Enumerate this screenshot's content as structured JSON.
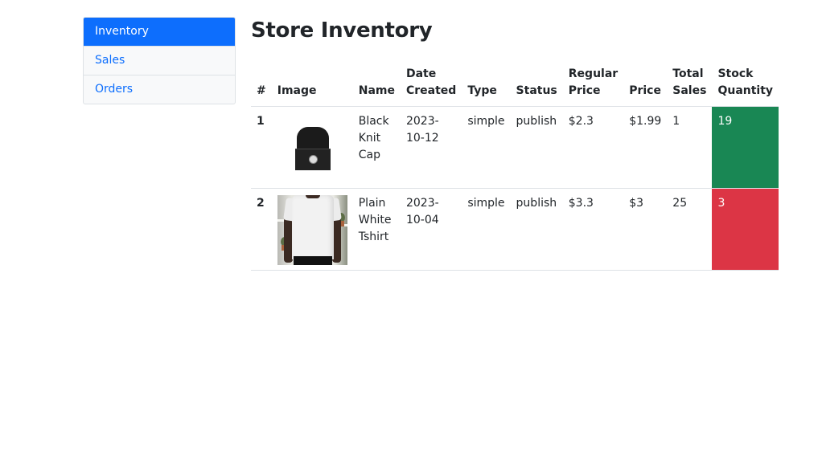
{
  "sidebar": {
    "items": [
      {
        "label": "Inventory",
        "active": true
      },
      {
        "label": "Sales",
        "active": false
      },
      {
        "label": "Orders",
        "active": false
      }
    ]
  },
  "page": {
    "title": "Store Inventory"
  },
  "table": {
    "headers": [
      {
        "line1": "",
        "line2": "#"
      },
      {
        "line1": "",
        "line2": "Image"
      },
      {
        "line1": "",
        "line2": "Name"
      },
      {
        "line1": "Date",
        "line2": "Created"
      },
      {
        "line1": "",
        "line2": "Type"
      },
      {
        "line1": "",
        "line2": "Status"
      },
      {
        "line1": "Regular",
        "line2": "Price"
      },
      {
        "line1": "",
        "line2": "Price"
      },
      {
        "line1": "Total",
        "line2": "Sales"
      },
      {
        "line1": "Stock",
        "line2": "Quantity"
      }
    ],
    "rows": [
      {
        "num": "1",
        "image": "black-knit-cap-image",
        "name_lines": [
          "Black",
          "Knit",
          "Cap"
        ],
        "date_created": "2023-10-12",
        "type": "simple",
        "status": "publish",
        "regular_price": "$2.3",
        "price": "$1.99",
        "total_sales": "1",
        "stock_quantity": "19",
        "stock_color": "#198754"
      },
      {
        "num": "2",
        "image": "plain-white-tshirt-image",
        "name_lines": [
          "Plain",
          "White",
          "Tshirt"
        ],
        "date_created": "2023-10-04",
        "type": "simple",
        "status": "publish",
        "regular_price": "$3.3",
        "price": "$3",
        "total_sales": "25",
        "stock_quantity": "3",
        "stock_color": "#dc3545"
      }
    ]
  },
  "colors": {
    "primary": "#0d6efd",
    "stock_ok": "#198754",
    "stock_low": "#dc3545"
  }
}
